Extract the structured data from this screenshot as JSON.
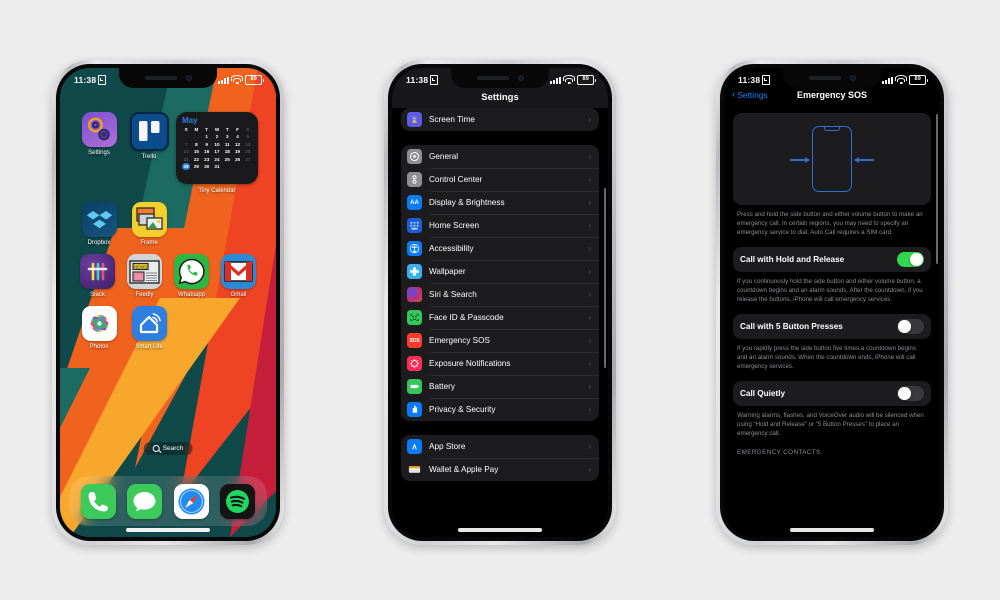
{
  "background_color": "#eeedee",
  "phones": {
    "home": {
      "name": "iPhone Home Screen",
      "status": {
        "time": "11:38",
        "alarm_icon": "alarm-icon",
        "signal_icon": "cellular-bars-icon",
        "wifi_icon": "wifi-icon",
        "battery_level": "89"
      },
      "apps_rows": [
        [
          {
            "label": "Settings",
            "icon": "settings-app-icon"
          },
          {
            "label": "Trello",
            "icon": "trello-app-icon"
          }
        ],
        [
          {
            "label": "Dropbox",
            "icon": "dropbox-app-icon"
          },
          {
            "label": "Frame",
            "icon": "frame-app-icon"
          }
        ],
        [
          {
            "label": "Slack",
            "icon": "slack-app-icon"
          },
          {
            "label": "Feedly",
            "icon": "feedly-app-icon"
          },
          {
            "label": "Whatsapp",
            "icon": "whatsapp-app-icon"
          },
          {
            "label": "Gmail",
            "icon": "gmail-app-icon"
          }
        ],
        [
          {
            "label": "Photos",
            "icon": "photos-app-icon"
          },
          {
            "label": "Smart Life",
            "icon": "smart-life-app-icon"
          }
        ]
      ],
      "widget": {
        "name": "Tiny Calendar",
        "month": "May",
        "weekday_headers": [
          "S",
          "M",
          "T",
          "W",
          "T",
          "F",
          "S"
        ],
        "weeks": [
          [
            {
              "d": "",
              "t": "blank"
            },
            {
              "d": "",
              "t": "blank"
            },
            {
              "d": "1",
              "t": "on"
            },
            {
              "d": "2",
              "t": "on"
            },
            {
              "d": "3",
              "t": "on"
            },
            {
              "d": "4",
              "t": "on"
            },
            {
              "d": "5",
              "t": "on"
            },
            {
              "d": "6",
              "t": "dim"
            }
          ],
          [
            {
              "d": "7",
              "t": "dim"
            },
            {
              "d": "8",
              "t": "on"
            },
            {
              "d": "9",
              "t": "on"
            },
            {
              "d": "10",
              "t": "on"
            },
            {
              "d": "11",
              "t": "on"
            },
            {
              "d": "12",
              "t": "on"
            },
            {
              "d": "13",
              "t": "dim"
            }
          ],
          [
            {
              "d": "14",
              "t": "dim"
            },
            {
              "d": "15",
              "t": "on"
            },
            {
              "d": "16",
              "t": "on"
            },
            {
              "d": "17",
              "t": "on"
            },
            {
              "d": "18",
              "t": "on"
            },
            {
              "d": "19",
              "t": "on"
            },
            {
              "d": "20",
              "t": "dim"
            }
          ],
          [
            {
              "d": "21",
              "t": "dim"
            },
            {
              "d": "22",
              "t": "on"
            },
            {
              "d": "23",
              "t": "on"
            },
            {
              "d": "24",
              "t": "on"
            },
            {
              "d": "25",
              "t": "on"
            },
            {
              "d": "26",
              "t": "on"
            },
            {
              "d": "27",
              "t": "dim"
            }
          ],
          [
            {
              "d": "28",
              "t": "today"
            },
            {
              "d": "29",
              "t": "on"
            },
            {
              "d": "30",
              "t": "on"
            },
            {
              "d": "31",
              "t": "on"
            }
          ]
        ]
      },
      "search_pill": {
        "label": "Search",
        "icon": "search-icon"
      },
      "dock": [
        {
          "label": "Phone",
          "icon": "phone-app-icon"
        },
        {
          "label": "Messages",
          "icon": "messages-app-icon"
        },
        {
          "label": "Safari",
          "icon": "safari-app-icon"
        },
        {
          "label": "Spotify",
          "icon": "spotify-app-icon"
        }
      ]
    },
    "settings": {
      "status": {
        "time": "11:38",
        "battery_level": "89"
      },
      "title": "Settings",
      "groups": [
        {
          "items": [
            {
              "label": "Screen Time",
              "icon": "hourglass-icon",
              "color": "#5e5ce6"
            }
          ]
        },
        {
          "items": [
            {
              "label": "General",
              "icon": "gear-icon",
              "color": "#8e8e93"
            },
            {
              "label": "Control Center",
              "icon": "sliders-icon",
              "color": "#8e8e93"
            },
            {
              "label": "Display & Brightness",
              "icon": "aa-icon",
              "color": "#0a7bf5"
            },
            {
              "label": "Home Screen",
              "icon": "grid-icon",
              "color": "#1c5ed6"
            },
            {
              "label": "Accessibility",
              "icon": "accessibility-icon",
              "color": "#0a7bf5"
            },
            {
              "label": "Wallpaper",
              "icon": "flower-icon",
              "color": "#3ab0f0"
            },
            {
              "label": "Siri & Search",
              "icon": "siri-icon",
              "color": "#c0306c"
            },
            {
              "label": "Face ID & Passcode",
              "icon": "faceid-icon",
              "color": "#34c759"
            },
            {
              "label": "Emergency SOS",
              "icon": "sos-icon",
              "color": "#ff3b30"
            },
            {
              "label": "Exposure Notifications",
              "icon": "virus-icon",
              "color": "#ff2d55"
            },
            {
              "label": "Battery",
              "icon": "battery-icon",
              "color": "#34c759"
            },
            {
              "label": "Privacy & Security",
              "icon": "hand-icon",
              "color": "#0a7bf5"
            }
          ]
        },
        {
          "items": [
            {
              "label": "App Store",
              "icon": "appstore-icon",
              "color": "#0a7bf5"
            },
            {
              "label": "Wallet & Apple Pay",
              "icon": "wallet-icon",
              "color": "#1c1c1e"
            }
          ]
        }
      ],
      "chevron": "›"
    },
    "sos": {
      "status": {
        "time": "11:38",
        "battery_level": "89"
      },
      "back_label": "Settings",
      "title": "Emergency SOS",
      "illustration_icon": "iphone-side-button-illustration",
      "intro_text": "Press and hold the side button and either volume button to make an emergency call. In certain regions, you may need to specify an emergency service to dial. Auto Call requires a SIM card.",
      "settings": [
        {
          "label": "Call with Hold and Release",
          "state": "on",
          "description": "If you continuously hold the side button and either volume button, a countdown begins and an alarm sounds. After the countdown, if you release the buttons, iPhone will call emergency services."
        },
        {
          "label": "Call with 5 Button Presses",
          "state": "off",
          "description": "If you rapidly press the side button five times a countdown begins and an alarm sounds. When the countdown ends, iPhone will call emergency services."
        },
        {
          "label": "Call Quietly",
          "state": "off",
          "description": "Warning alarms, flashes, and VoiceOver audio will be silenced when using “Hold and Release” or “5 Button Presses” to place an emergency call."
        }
      ],
      "section_header": "EMERGENCY CONTACTS"
    }
  }
}
